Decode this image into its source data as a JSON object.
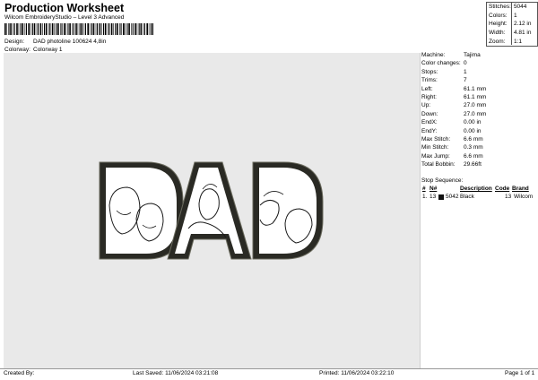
{
  "header": {
    "title": "Production Worksheet",
    "subtitle": "Wilcom EmbroideryStudio – Level 3 Advanced",
    "design_label": "Design:",
    "design_value": "DAD photoline 100624 4,8in",
    "colorway_label": "Colorway:",
    "colorway_value": "Colorway 1"
  },
  "summary": [
    {
      "label": "Stitches:",
      "value": "5044"
    },
    {
      "label": "Colors:",
      "value": "1"
    },
    {
      "label": "Height:",
      "value": "2.12 in"
    },
    {
      "label": "Width:",
      "value": "4.81 in"
    },
    {
      "label": "Zoom:",
      "value": "1:1"
    }
  ],
  "design": {
    "text": "DAD",
    "fill_color": "#ffffff",
    "outline_color": "#2a2a24",
    "border_color": "#6b6b5e"
  },
  "info": [
    {
      "label": "Machine:",
      "value": "Tajima"
    },
    {
      "label": "Color changes:",
      "value": "0"
    },
    {
      "label": "Stops:",
      "value": "1"
    },
    {
      "label": "Trims:",
      "value": "7"
    },
    {
      "label": "Left:",
      "value": "61.1 mm"
    },
    {
      "label": "Right:",
      "value": "61.1 mm"
    },
    {
      "label": "Up:",
      "value": "27.0 mm"
    },
    {
      "label": "Down:",
      "value": "27.0 mm"
    },
    {
      "label": "EndX:",
      "value": "0.00 in"
    },
    {
      "label": "EndY:",
      "value": "0.00 in"
    },
    {
      "label": "Max Stitch:",
      "value": "6.6 mm"
    },
    {
      "label": "Min Stitch:",
      "value": "0.3 mm"
    },
    {
      "label": "Max Jump:",
      "value": "6.6 mm"
    },
    {
      "label": "Total Bobbin:",
      "value": "29.66ft"
    }
  ],
  "stop_sequence": {
    "title": "Stop Sequence:",
    "columns": [
      "#",
      "N#",
      "Description",
      "Code",
      "Brand"
    ],
    "rows": [
      {
        "index": "1.",
        "n": "13",
        "stitches": "5042",
        "description": "Black",
        "code": "13",
        "brand": "Wilcom",
        "color": "#111111"
      }
    ]
  },
  "footer": {
    "created": "Created By:",
    "saved": "Last Saved: 11/06/2024 03:21:08",
    "printed": "Printed: 11/06/2024 03:22:10",
    "page": "Page 1 of 1"
  }
}
